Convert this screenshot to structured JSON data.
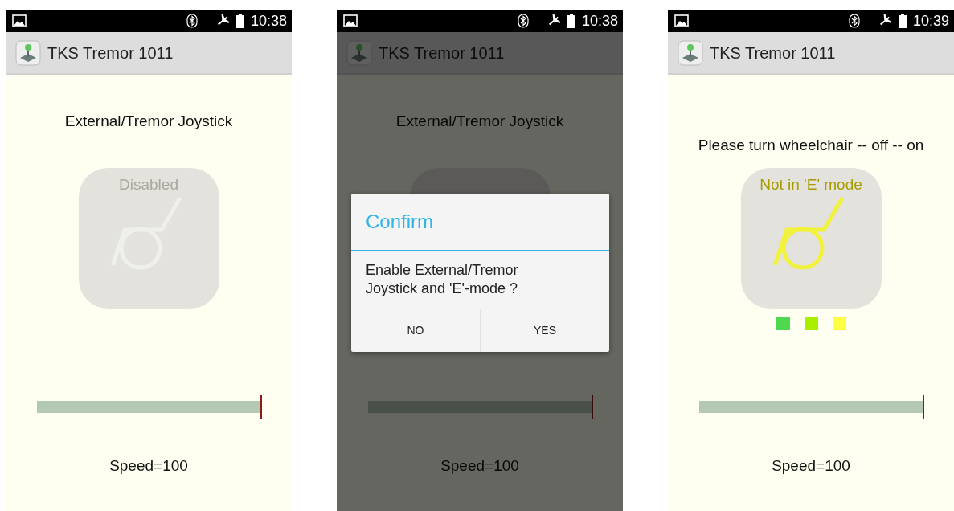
{
  "screens": [
    {
      "status_bar": {
        "time": "10:38"
      },
      "app_bar": {
        "title": "TKS Tremor 1011"
      },
      "heading": "External/Tremor Joystick",
      "tile": {
        "kind": "disabled",
        "label": "Disabled"
      },
      "speed": {
        "level": 1.0,
        "label": "Speed=100"
      }
    },
    {
      "status_bar": {
        "time": "10:38"
      },
      "app_bar": {
        "title": "TKS Tremor 1011"
      },
      "heading": "External/Tremor Joystick",
      "tile": {
        "kind": "disabled"
      },
      "speed": {
        "level": 1.0,
        "label": "Speed=100"
      },
      "dialog": {
        "title": "Confirm",
        "message": "Enable External/Tremor Joystick and 'E'-mode ?",
        "buttons": [
          "NO",
          "YES"
        ]
      }
    },
    {
      "status_bar": {
        "time": "10:39"
      },
      "app_bar": {
        "title": "TKS Tremor 1011"
      },
      "heading": "Please turn wheelchair -- off -- on",
      "tile": {
        "kind": "warning",
        "label": "Not in 'E' mode"
      },
      "indicators": [
        {
          "color": "#4fd84f"
        },
        {
          "color": "#aaee00"
        },
        {
          "color": "#ffff44"
        }
      ],
      "speed": {
        "level": 1.0,
        "label": "Speed=100"
      }
    }
  ]
}
